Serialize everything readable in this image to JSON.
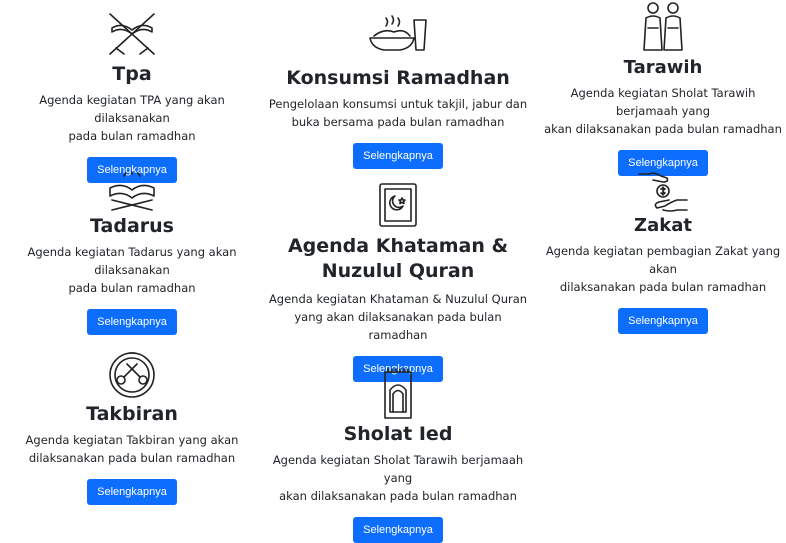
{
  "cards": {
    "tpa": {
      "title": "Tpa",
      "desc_line1": "Agenda kegiatan TPA yang akan dilaksanakan",
      "desc_line2": "pada bulan ramadhan",
      "button": "Selengkapnya",
      "icon": "quran-stand-icon"
    },
    "konsumsi": {
      "title": "Konsumsi Ramadhan",
      "desc_line1": "Pengelolaan konsumsi untuk takjil, jabur dan",
      "desc_line2": "buka bersama pada bulan ramadhan",
      "button": "Selengkapnya",
      "icon": "food-bowl-icon"
    },
    "tarawih": {
      "title": "Tarawih",
      "desc_line1": "Agenda kegiatan Sholat Tarawih berjamaah yang",
      "desc_line2": "akan dilaksanakan pada bulan ramadhan",
      "button": "Selengkapnya",
      "icon": "praying-people-icon"
    },
    "tadarus": {
      "title": "Tadarus",
      "desc_line1": "Agenda kegiatan Tadarus yang akan dilaksanakan",
      "desc_line2": "pada bulan ramadhan",
      "button": "Selengkapnya",
      "icon": "open-quran-icon"
    },
    "khataman": {
      "title_line1": "Agenda Khataman &",
      "title_line2": "Nuzulul Quran",
      "desc_line1": "Agenda kegiatan Khataman & Nuzulul Quran",
      "desc_line2": "yang akan dilaksanakan pada bulan ramadhan",
      "button": "Selengkapnya",
      "icon": "quran-book-icon"
    },
    "zakat": {
      "title": "Zakat",
      "desc_line1": "Agenda kegiatan pembagian Zakat yang akan",
      "desc_line2": "dilaksanakan pada bulan ramadhan",
      "button": "Selengkapnya",
      "icon": "zakat-hands-icon"
    },
    "takbiran": {
      "title": "Takbiran",
      "desc_line1": "Agenda kegiatan Takbiran yang akan",
      "desc_line2": "dilaksanakan pada bulan ramadhan",
      "button": "Selengkapnya",
      "icon": "drum-icon"
    },
    "sholat_ied": {
      "title": "Sholat Ied",
      "desc_line1": "Agenda kegiatan Sholat Tarawih berjamaah yang",
      "desc_line2": "akan dilaksanakan pada bulan ramadhan",
      "button": "Selengkapnya",
      "icon": "prayer-mat-icon"
    }
  },
  "colors": {
    "primary": "#0d6efd",
    "text": "#212529",
    "background": "#ffffff"
  }
}
